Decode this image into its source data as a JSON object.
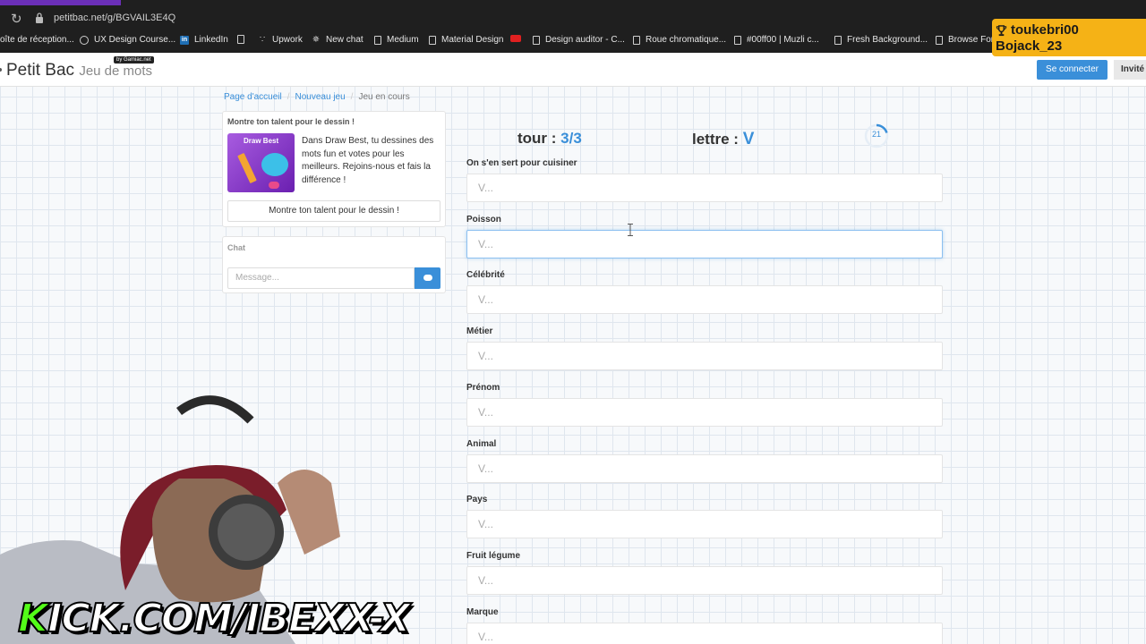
{
  "browser": {
    "url": "petitbac.net/g/BGVAIL3E4Q",
    "bookmarks": [
      {
        "label": "oîte de réception...",
        "icon": "doc-icon"
      },
      {
        "label": "UX Design Course...",
        "icon": "circle-icon"
      },
      {
        "label": "LinkedIn",
        "icon": "linkedin-icon"
      },
      {
        "label": "",
        "icon": "doc-icon"
      },
      {
        "label": "Upwork",
        "icon": "upwork-icon"
      },
      {
        "label": "New chat",
        "icon": "openai-icon"
      },
      {
        "label": "Medium",
        "icon": "doc-icon"
      },
      {
        "label": "Material Design",
        "icon": "doc-icon"
      },
      {
        "label": "",
        "icon": "youtube-icon"
      },
      {
        "label": "Design auditor - C...",
        "icon": "doc-icon"
      },
      {
        "label": "Roue chromatique...",
        "icon": "doc-icon"
      },
      {
        "label": "#00ff00 | Muzli c...",
        "icon": "doc-icon"
      },
      {
        "label": "Fresh Background...",
        "icon": "doc-icon"
      },
      {
        "label": "Browse Fon",
        "icon": "doc-icon"
      }
    ]
  },
  "overlay": {
    "viewer_1": "toukebri00",
    "viewer_2": "Bojack_23",
    "channel": "KICK.COM/IBEXX-X"
  },
  "header": {
    "brand": "Petit Bac",
    "brand_sub": "Jeu de mots",
    "gamiac": "by Gamiac.net",
    "login": "Se connecter",
    "guest": "Invité"
  },
  "breadcrumb": {
    "home": "Page d'accueil",
    "new_game": "Nouveau jeu",
    "current": "Jeu en cours"
  },
  "promo": {
    "title": "Montre ton talent pour le dessin !",
    "thumb_title": "Draw Best",
    "description": "Dans Draw Best, tu dessines des mots fun et votes pour les meilleurs. Rejoins-nous et fais la différence !",
    "cta": "Montre ton talent pour le dessin !"
  },
  "chat": {
    "title": "Chat",
    "placeholder": "Message..."
  },
  "game": {
    "tour_label": "tour :",
    "tour_value": "3/3",
    "letter_label": "lettre :",
    "letter_value": "V",
    "timer": "21",
    "timer_fraction": 0.2,
    "fields": [
      {
        "label": "On s'en sert pour cuisiner",
        "placeholder": "V..."
      },
      {
        "label": "Poisson",
        "placeholder": "V..."
      },
      {
        "label": "Célébrité",
        "placeholder": "V..."
      },
      {
        "label": "Métier",
        "placeholder": "V..."
      },
      {
        "label": "Prénom",
        "placeholder": "V..."
      },
      {
        "label": "Animal",
        "placeholder": "V..."
      },
      {
        "label": "Pays",
        "placeholder": "V..."
      },
      {
        "label": "Fruit légume",
        "placeholder": "V..."
      },
      {
        "label": "Marque",
        "placeholder": "V..."
      }
    ]
  },
  "colors": {
    "accent": "#3a8fd9",
    "overlay": "#f5b216",
    "kick_green": "#53fc18"
  }
}
